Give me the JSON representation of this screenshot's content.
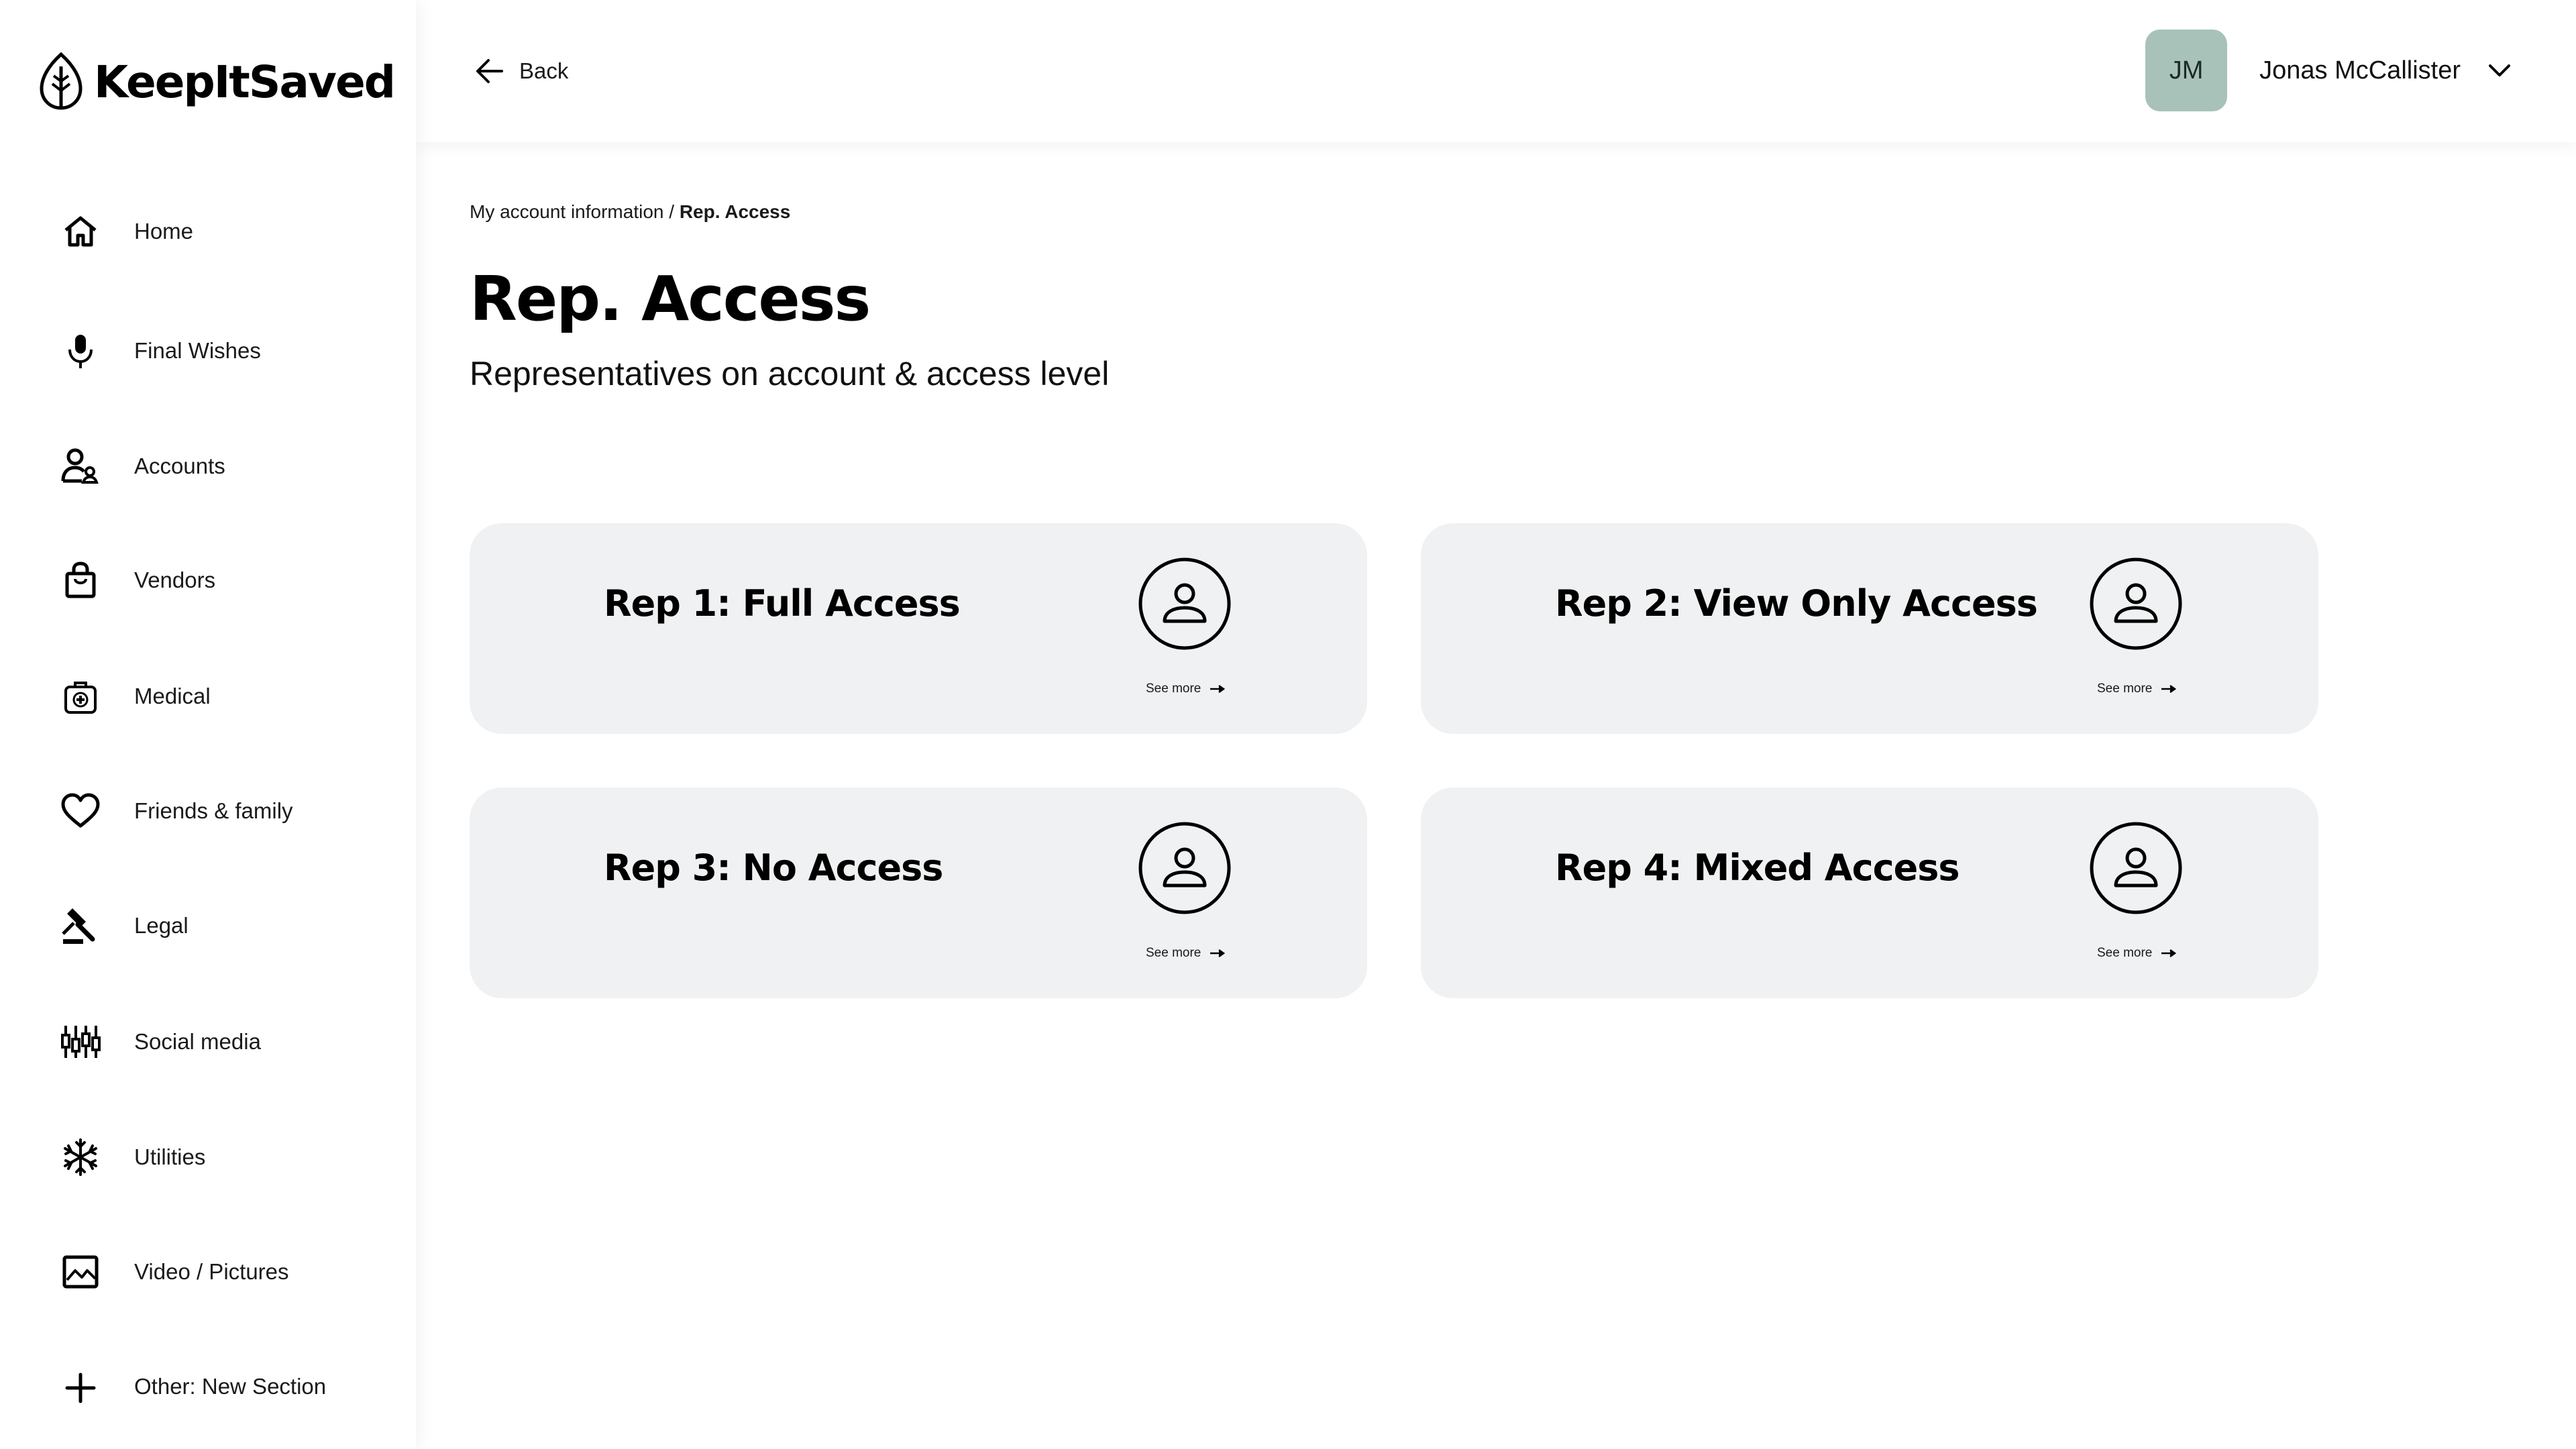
{
  "brand": {
    "name": "KeepItSaved",
    "icon": "leaf-icon"
  },
  "sidebar": {
    "items": [
      {
        "label": "Home",
        "icon": "home-icon"
      },
      {
        "label": "Final Wishes",
        "icon": "microphone-icon"
      },
      {
        "label": "Accounts",
        "icon": "users-icon"
      },
      {
        "label": "Vendors",
        "icon": "shopping-bag-icon"
      },
      {
        "label": "Medical",
        "icon": "medical-kit-icon"
      },
      {
        "label": "Friends & family",
        "icon": "heart-icon"
      },
      {
        "label": "Legal",
        "icon": "gavel-icon"
      },
      {
        "label": "Social media",
        "icon": "sliders-icon"
      },
      {
        "label": "Utilities",
        "icon": "snowflake-icon"
      },
      {
        "label": "Video / Pictures",
        "icon": "image-icon"
      },
      {
        "label": "Other: New Section",
        "icon": "plus-icon"
      }
    ]
  },
  "topbar": {
    "back_label": "Back",
    "user": {
      "initials": "JM",
      "name": "Jonas McCallister",
      "avatar_color": "#a8c2b9"
    }
  },
  "breadcrumb": {
    "parent": "My account information",
    "separator": " / ",
    "current": "Rep. Access"
  },
  "page": {
    "title": "Rep. Access",
    "subtitle": "Representatives on account & access level"
  },
  "cards": [
    {
      "title": "Rep 1: Full Access",
      "link": "See more",
      "icon": "user-circle-icon"
    },
    {
      "title": "Rep 2: View Only Access",
      "link": "See more",
      "icon": "user-circle-icon"
    },
    {
      "title": "Rep 3: No Access",
      "link": "See more",
      "icon": "user-circle-icon"
    },
    {
      "title": "Rep 4: Mixed Access",
      "link": "See more",
      "icon": "user-circle-icon"
    }
  ],
  "colors": {
    "card_bg": "#f0f1f2",
    "avatar_bg": "#a8c2b9",
    "text": "#111111"
  }
}
